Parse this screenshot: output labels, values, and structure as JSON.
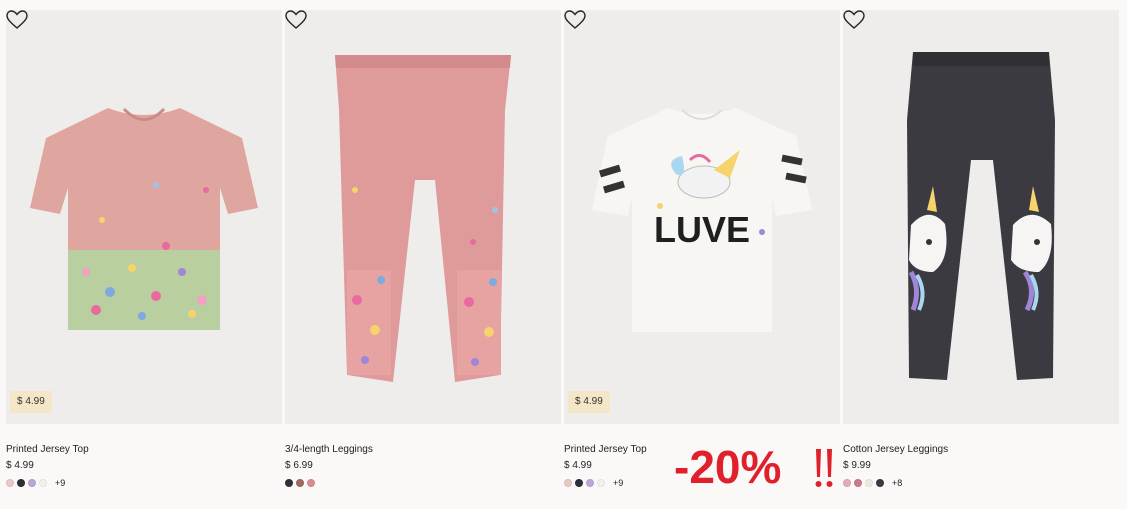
{
  "products": [
    {
      "title": "Printed Jersey Top",
      "price": "$ 4.99",
      "tag_price": "$ 4.99",
      "swatches": [
        "#e8c9c6",
        "#2d2f3a",
        "#b9a8d6",
        "#f2f1ef"
      ],
      "more": "+9"
    },
    {
      "title": "3/4-length Leggings",
      "price": "$ 6.99",
      "swatches": [
        "#2d2f3a",
        "#a06a5c",
        "#d98e8e"
      ]
    },
    {
      "title": "Printed Jersey Top",
      "price": "$ 4.99",
      "tag_price": "$ 4.99",
      "swatches": [
        "#e8c9c6",
        "#2d2f3a",
        "#b9a8d6",
        "#f2f1ef"
      ],
      "more": "+9"
    },
    {
      "title": "Cotton Jersey Leggings",
      "price": "$ 9.99",
      "swatches": [
        "#e6a9b6",
        "#c77b8b",
        "#efe9e3",
        "#3a3a40"
      ],
      "more": "+8"
    }
  ],
  "promo": {
    "text": "-20%",
    "marks": "!!",
    "color": "#e0202a"
  },
  "icons": {
    "favorite": "heart-outline-icon"
  }
}
